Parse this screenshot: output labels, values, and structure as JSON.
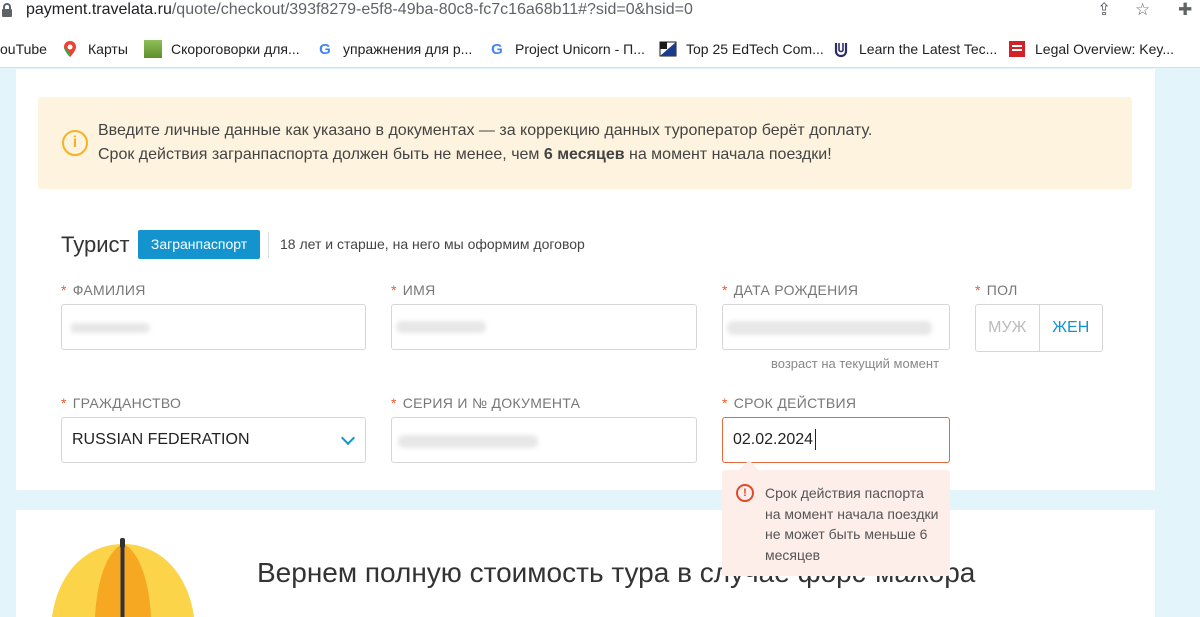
{
  "browser": {
    "url_host": "payment.travelata.ru",
    "url_path": "/quote/checkout/393f8279-e5f8-49ba-80c8-fc7c16a68b11#?sid=0&hsid=0",
    "bookmarks": [
      {
        "label": "ouTube",
        "icon": "youtube-icon"
      },
      {
        "label": "Карты",
        "icon": "maps-icon"
      },
      {
        "label": "Скороговорки для...",
        "icon": "image-icon"
      },
      {
        "label": "упражнения для р...",
        "icon": "google-icon"
      },
      {
        "label": "Project Unicorn - П...",
        "icon": "google-icon"
      },
      {
        "label": "Top 25 EdTech Com...",
        "icon": "flag-icon"
      },
      {
        "label": "Learn the Latest Tec...",
        "icon": "udacity-icon"
      },
      {
        "label": "Legal Overview: Key...",
        "icon": "document-icon"
      }
    ]
  },
  "notice": {
    "line1": "Введите личные данные как указано в документах — за коррекцию данных туроператор берёт доплату.",
    "line2_pre": "Срок действия загранпаспорта должен быть не менее, чем ",
    "line2_bold": "6 месяцев",
    "line2_post": " на момент начала поездки!"
  },
  "tourist": {
    "title": "Турист",
    "badge": "Загранпаспорт",
    "subtitle": "18 лет и старше, на него мы оформим договор"
  },
  "form": {
    "required_mark": "*",
    "surname_label": "ФАМИЛИЯ",
    "name_label": "ИМЯ",
    "birthdate_label": "ДАТА РОЖДЕНИЯ",
    "birthdate_hint": "возраст на текущий момент",
    "gender_label": "ПОЛ",
    "gender_male": "МУЖ",
    "gender_female": "ЖЕН",
    "citizenship_label": "ГРАЖДАНСТВО",
    "citizenship_value": "RUSSIAN FEDERATION",
    "document_label": "СЕРИЯ И № ДОКУМЕНТА",
    "expiry_label": "СРОК ДЕЙСТВИЯ",
    "expiry_value": "02.02.2024",
    "error_text": "Срок действия паспорта на момент начала поездки не может быть меньше 6 месяцев"
  },
  "promo": {
    "title": "Вернем полную стоимость тура в случае форс-мажора"
  },
  "colors": {
    "accent": "#1494cf",
    "error": "#e2492b",
    "notice_bg": "#fdf3de"
  }
}
